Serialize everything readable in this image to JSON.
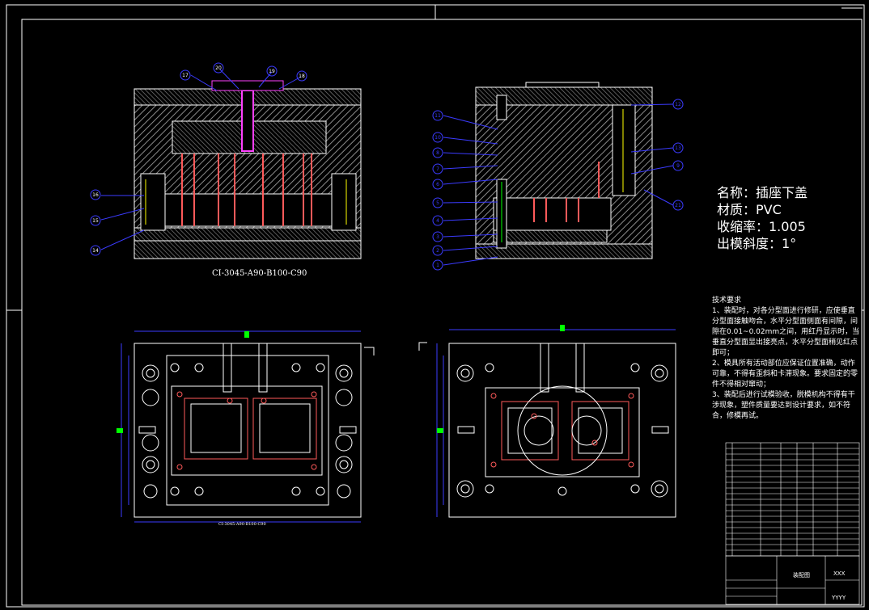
{
  "spec": {
    "name_line": "名称：插座下盖",
    "material_line": "材质：PVC",
    "shrink_line": "收缩率：1.005",
    "draft_line": "出模斜度：1°"
  },
  "captions": {
    "top_left": "CI-3045-A90-B100-C90",
    "bottom_left": "CI-3045-A90-B100-C90"
  },
  "tech_requirements": {
    "title": "技术要求",
    "items": [
      "1、装配时，对各分型面进行修研，应使垂直分型面接触吻合，水平分型面侧面有间隙，间隙在0.01~0.02mm之间，用红丹显示时，当垂直分型面显出接亮点，水平分型面稍见红点即可；",
      "2、模具所有活动部位应保证位置准确，动作可靠，不得有歪斜和卡滞现象。要求固定的零件不得相对窜动；",
      "3、装配后进行试模验收，脱模机构不得有干涉现象，塑件质量要达到设计要求，如不符合，修模再试。"
    ]
  },
  "balloons_left": [
    "17",
    "20",
    "19",
    "18",
    "16",
    "15",
    "14"
  ],
  "balloons_right": [
    "11",
    "10",
    "8",
    "7",
    "6",
    "5",
    "4",
    "3",
    "2",
    "1",
    "12",
    "13",
    "9",
    "21"
  ],
  "title_block": {
    "center_label": "装配图",
    "right_top": "XXX",
    "right_bottom": "YYYY"
  },
  "colors": {
    "background": "#000000",
    "line": "#ffffff",
    "hatch": "#9a9a9a",
    "dimension": "#3b3bff",
    "pin": "#ff5a5a",
    "sprue": "#ff40ff",
    "accent": "#00ff00",
    "yellow": "#ffff00"
  }
}
